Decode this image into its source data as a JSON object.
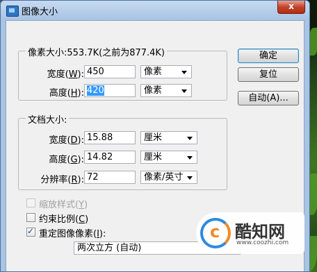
{
  "window": {
    "title": "图像大小",
    "close_label": "x"
  },
  "pixel_dimensions": {
    "legend": "像素大小:553.7K(之前为877.4K)",
    "width_label": "宽度(",
    "width_key": "W",
    "width_value": "450",
    "width_unit": "像素",
    "height_label": "高度(",
    "height_key": "H",
    "height_value": "420",
    "height_unit": "像素"
  },
  "document_size": {
    "legend": "文档大小:",
    "width_label": "宽度(",
    "width_key": "D",
    "width_value": "15.88",
    "width_unit": "厘米",
    "height_label": "高度(",
    "height_key": "G",
    "height_value": "14.82",
    "height_unit": "厘米",
    "resolution_label": "分辨率(",
    "resolution_key": "R",
    "resolution_value": "72",
    "resolution_unit": "像素/英寸"
  },
  "buttons": {
    "ok": "确定",
    "reset": "复位",
    "auto": "自动(A)..."
  },
  "options": {
    "scale_styles": {
      "label": "缩放样式(",
      "key": "Y",
      "checked": false,
      "disabled": true
    },
    "constrain": {
      "label": "约束比例(",
      "key": "C",
      "checked": false,
      "disabled": false
    },
    "resample": {
      "label": "重定图像像素(",
      "key": "I",
      "checked": true,
      "disabled": false
    },
    "resample_method": "两次立方 (自动)"
  },
  "watermark": {
    "name": "酷知网",
    "url": "www.coozhi.com"
  }
}
